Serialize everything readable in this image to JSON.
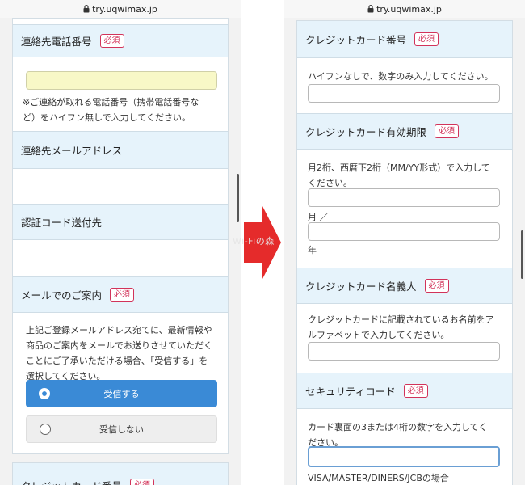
{
  "left": {
    "url": "try.uqwimax.jp",
    "phone_section": {
      "title": "連絡先電話番号",
      "required": "必須",
      "note": [
        "※ご連絡が取れる電話番号（携帯電話番号な",
        "ど）をハイフン無しで入力してください。"
      ]
    },
    "email_section": {
      "title": "連絡先メールアドレス"
    },
    "auth_section": {
      "title": "認証コード送付先"
    },
    "mail_info_section": {
      "title": "メールでのご案内",
      "required": "必須",
      "text": [
        "上記ご登録メールアドレス宛てに、最新情報や",
        "商品のご案内をメールでお送りさせていただく",
        "ことにご了承いただける場合、「受信する」を",
        "選択してください。"
      ],
      "option_receive": "受信する",
      "option_decline": "受信しない",
      "selected": "受信する"
    },
    "credit_peek": {
      "title": "クレジットカード番号",
      "required": "必須"
    }
  },
  "right": {
    "url": "try.uqwimax.jp",
    "card_number": {
      "title": "クレジットカード番号",
      "required": "必須",
      "hint": "ハイフンなしで、数字のみ入力してください。"
    },
    "card_expiry": {
      "title": "クレジットカード有効期限",
      "required": "必須",
      "hint": [
        "月2桁、西暦下2桁（MM/YY形式）で入力して",
        "ください。"
      ],
      "month_suffix": "月 ／",
      "year_suffix": "年"
    },
    "card_name": {
      "title": "クレジットカード名義人",
      "required": "必須",
      "hint": [
        "クレジットカードに記載されているお名前をア",
        "ルファベットで入力してください。"
      ]
    },
    "security_code": {
      "title": "セキュリティコード",
      "required": "必須",
      "hint": [
        "カード裏面の3または4桁の数字を入力してく",
        "ださい。"
      ],
      "footnote": "VISA/MASTER/DINERS/JCBの場合"
    }
  },
  "watermark": "Wi-Fiの森"
}
